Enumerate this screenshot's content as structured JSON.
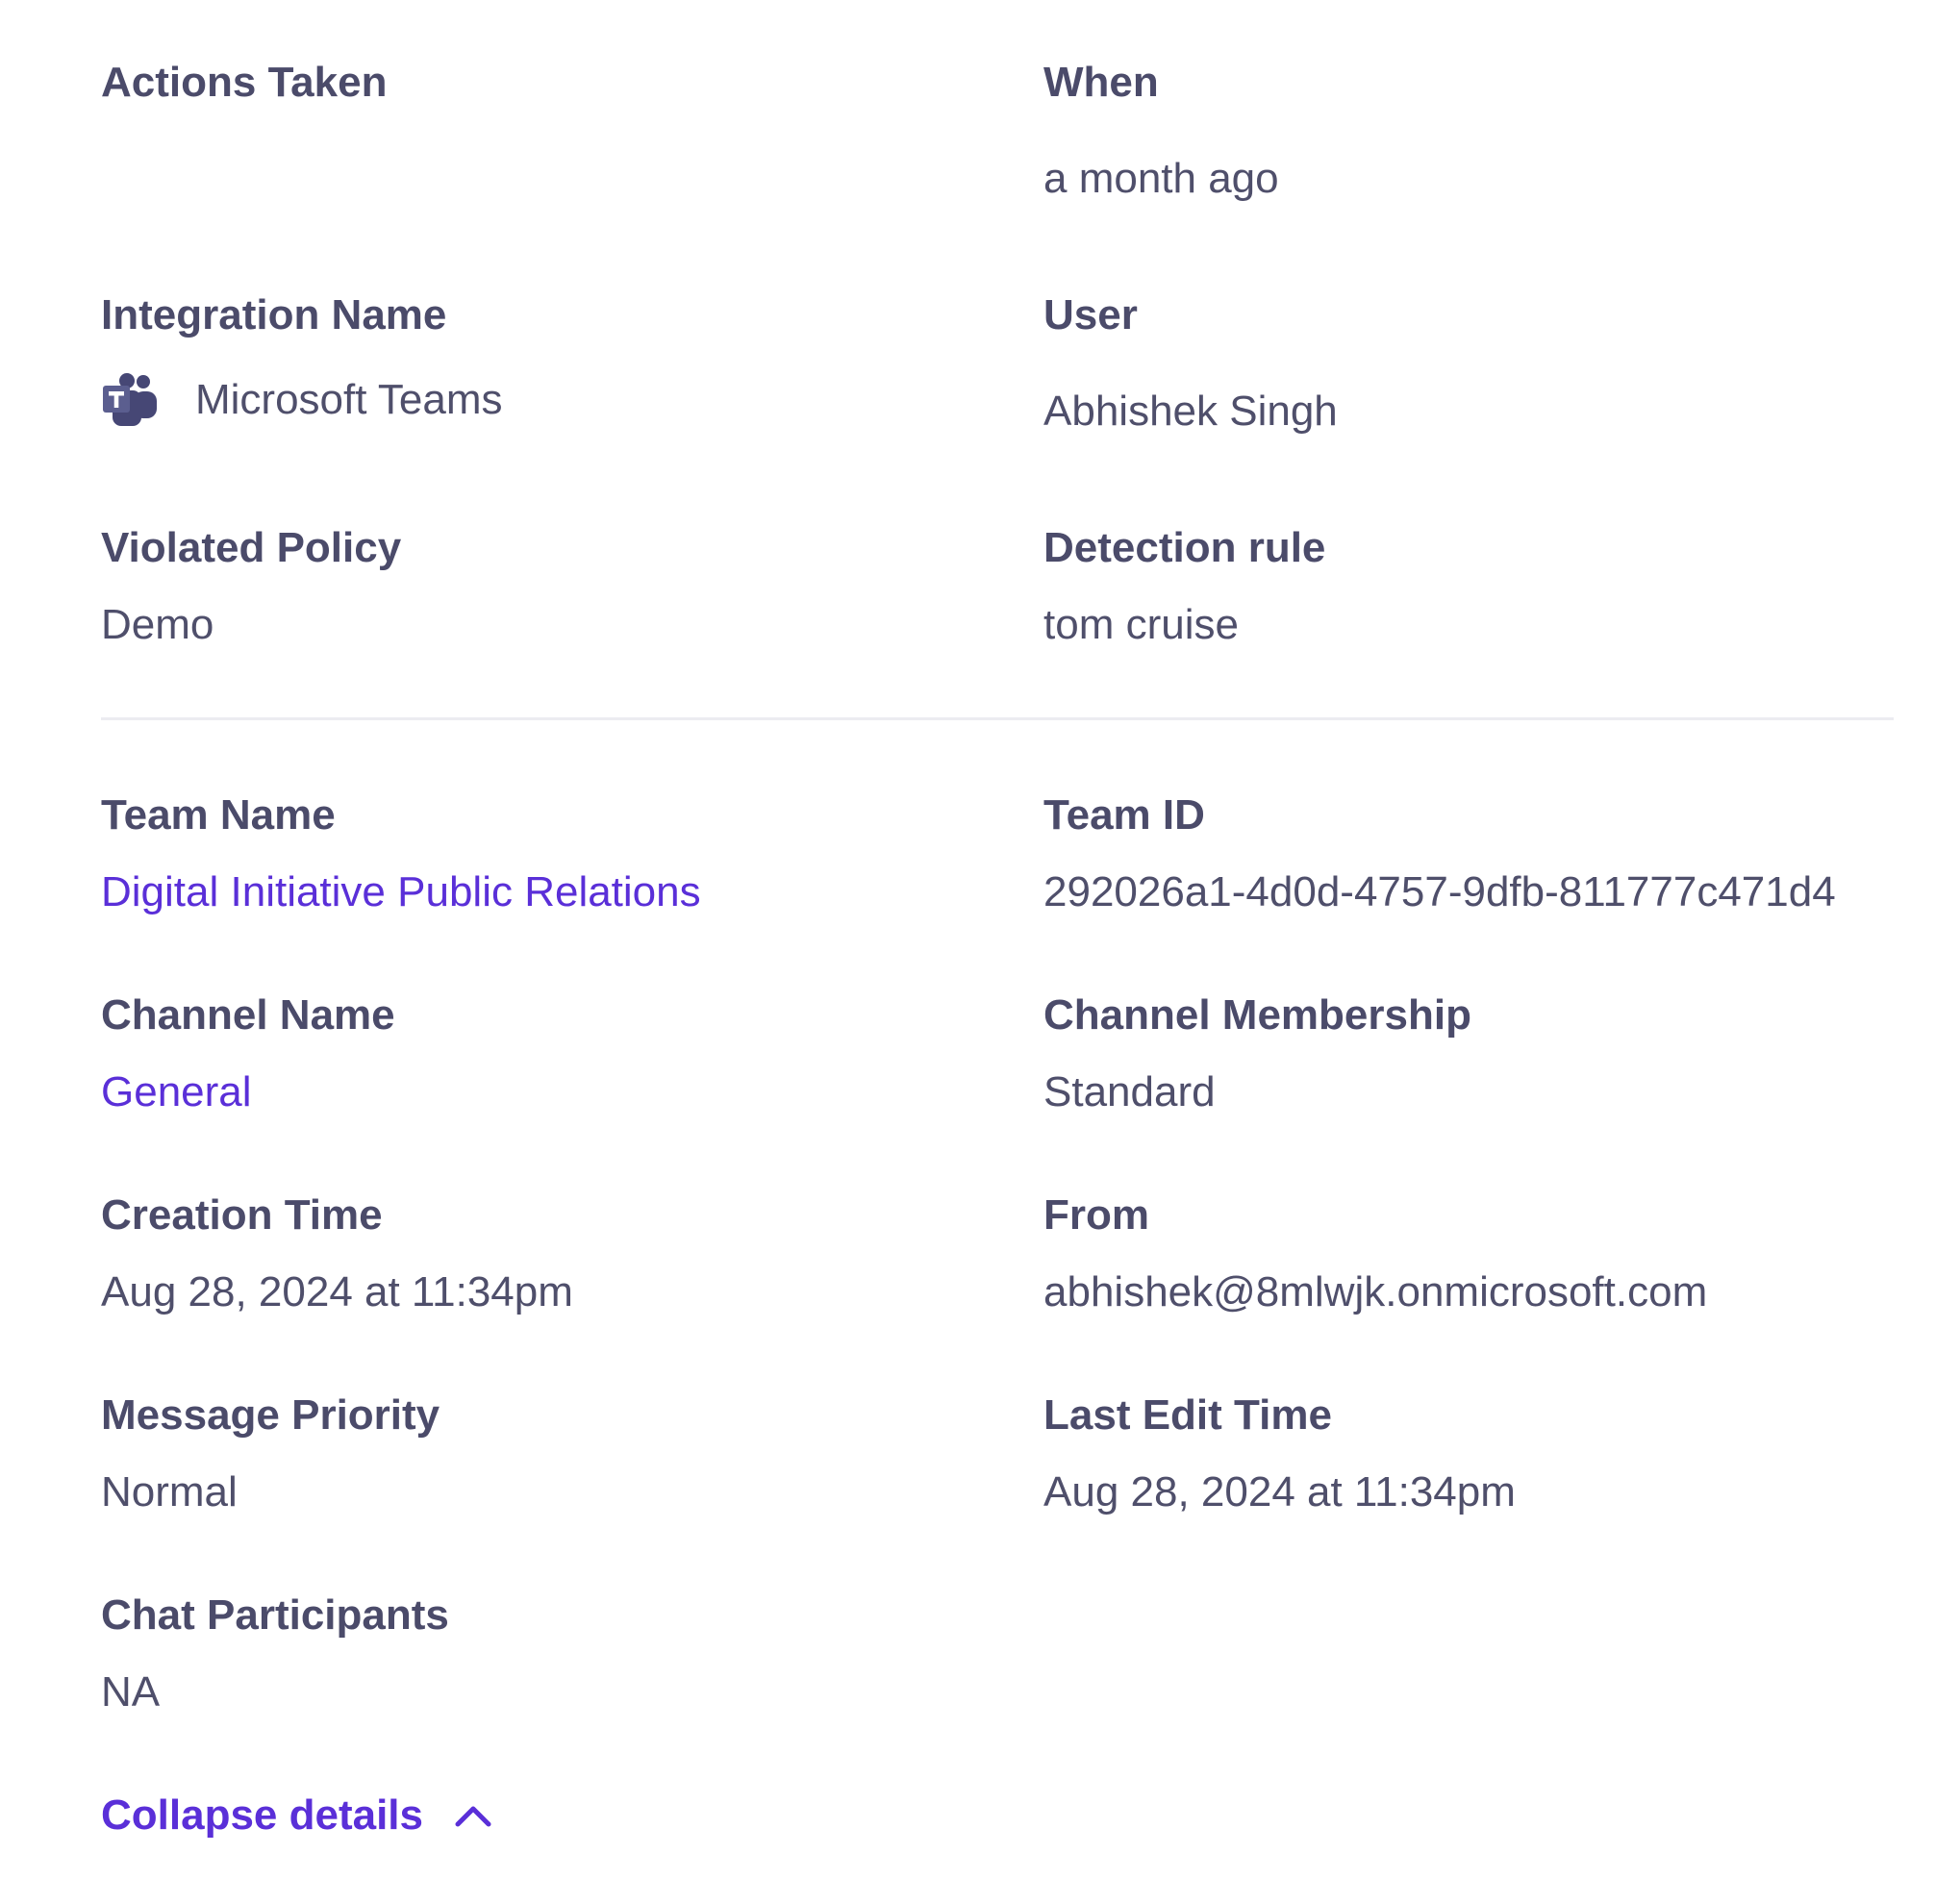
{
  "details": {
    "actions_taken": {
      "label": "Actions Taken"
    },
    "when": {
      "label": "When",
      "value": "a month ago"
    },
    "integration_name": {
      "label": "Integration Name",
      "value": "Microsoft Teams",
      "icon": "microsoft-teams-icon"
    },
    "user": {
      "label": "User",
      "value": "Abhishek Singh"
    },
    "violated_policy": {
      "label": "Violated Policy",
      "value": "Demo"
    },
    "detection_rule": {
      "label": "Detection rule",
      "value": "tom cruise"
    }
  },
  "extra": {
    "team_name": {
      "label": "Team Name",
      "value": "Digital Initiative Public Relations"
    },
    "team_id": {
      "label": "Team ID",
      "value": "292026a1-4d0d-4757-9dfb-811777c471d4"
    },
    "channel_name": {
      "label": "Channel Name",
      "value": "General"
    },
    "channel_membership": {
      "label": "Channel Membership",
      "value": "Standard"
    },
    "creation_time": {
      "label": "Creation Time",
      "value": "Aug 28, 2024 at 11:34pm"
    },
    "from": {
      "label": "From",
      "value": "abhishek@8mlwjk.onmicrosoft.com"
    },
    "message_priority": {
      "label": "Message Priority",
      "value": "Normal"
    },
    "last_edit_time": {
      "label": "Last Edit Time",
      "value": "Aug 28, 2024 at 11:34pm"
    },
    "chat_participants": {
      "label": "Chat Participants",
      "value": "NA"
    }
  },
  "collapse": {
    "label": "Collapse details",
    "icon": "chevron-up-icon"
  },
  "colors": {
    "label": "#4b4b6a",
    "value": "#4f4f6b",
    "link": "#5a2fd8",
    "divider": "#ececf1",
    "teams_icon": "#464775"
  }
}
